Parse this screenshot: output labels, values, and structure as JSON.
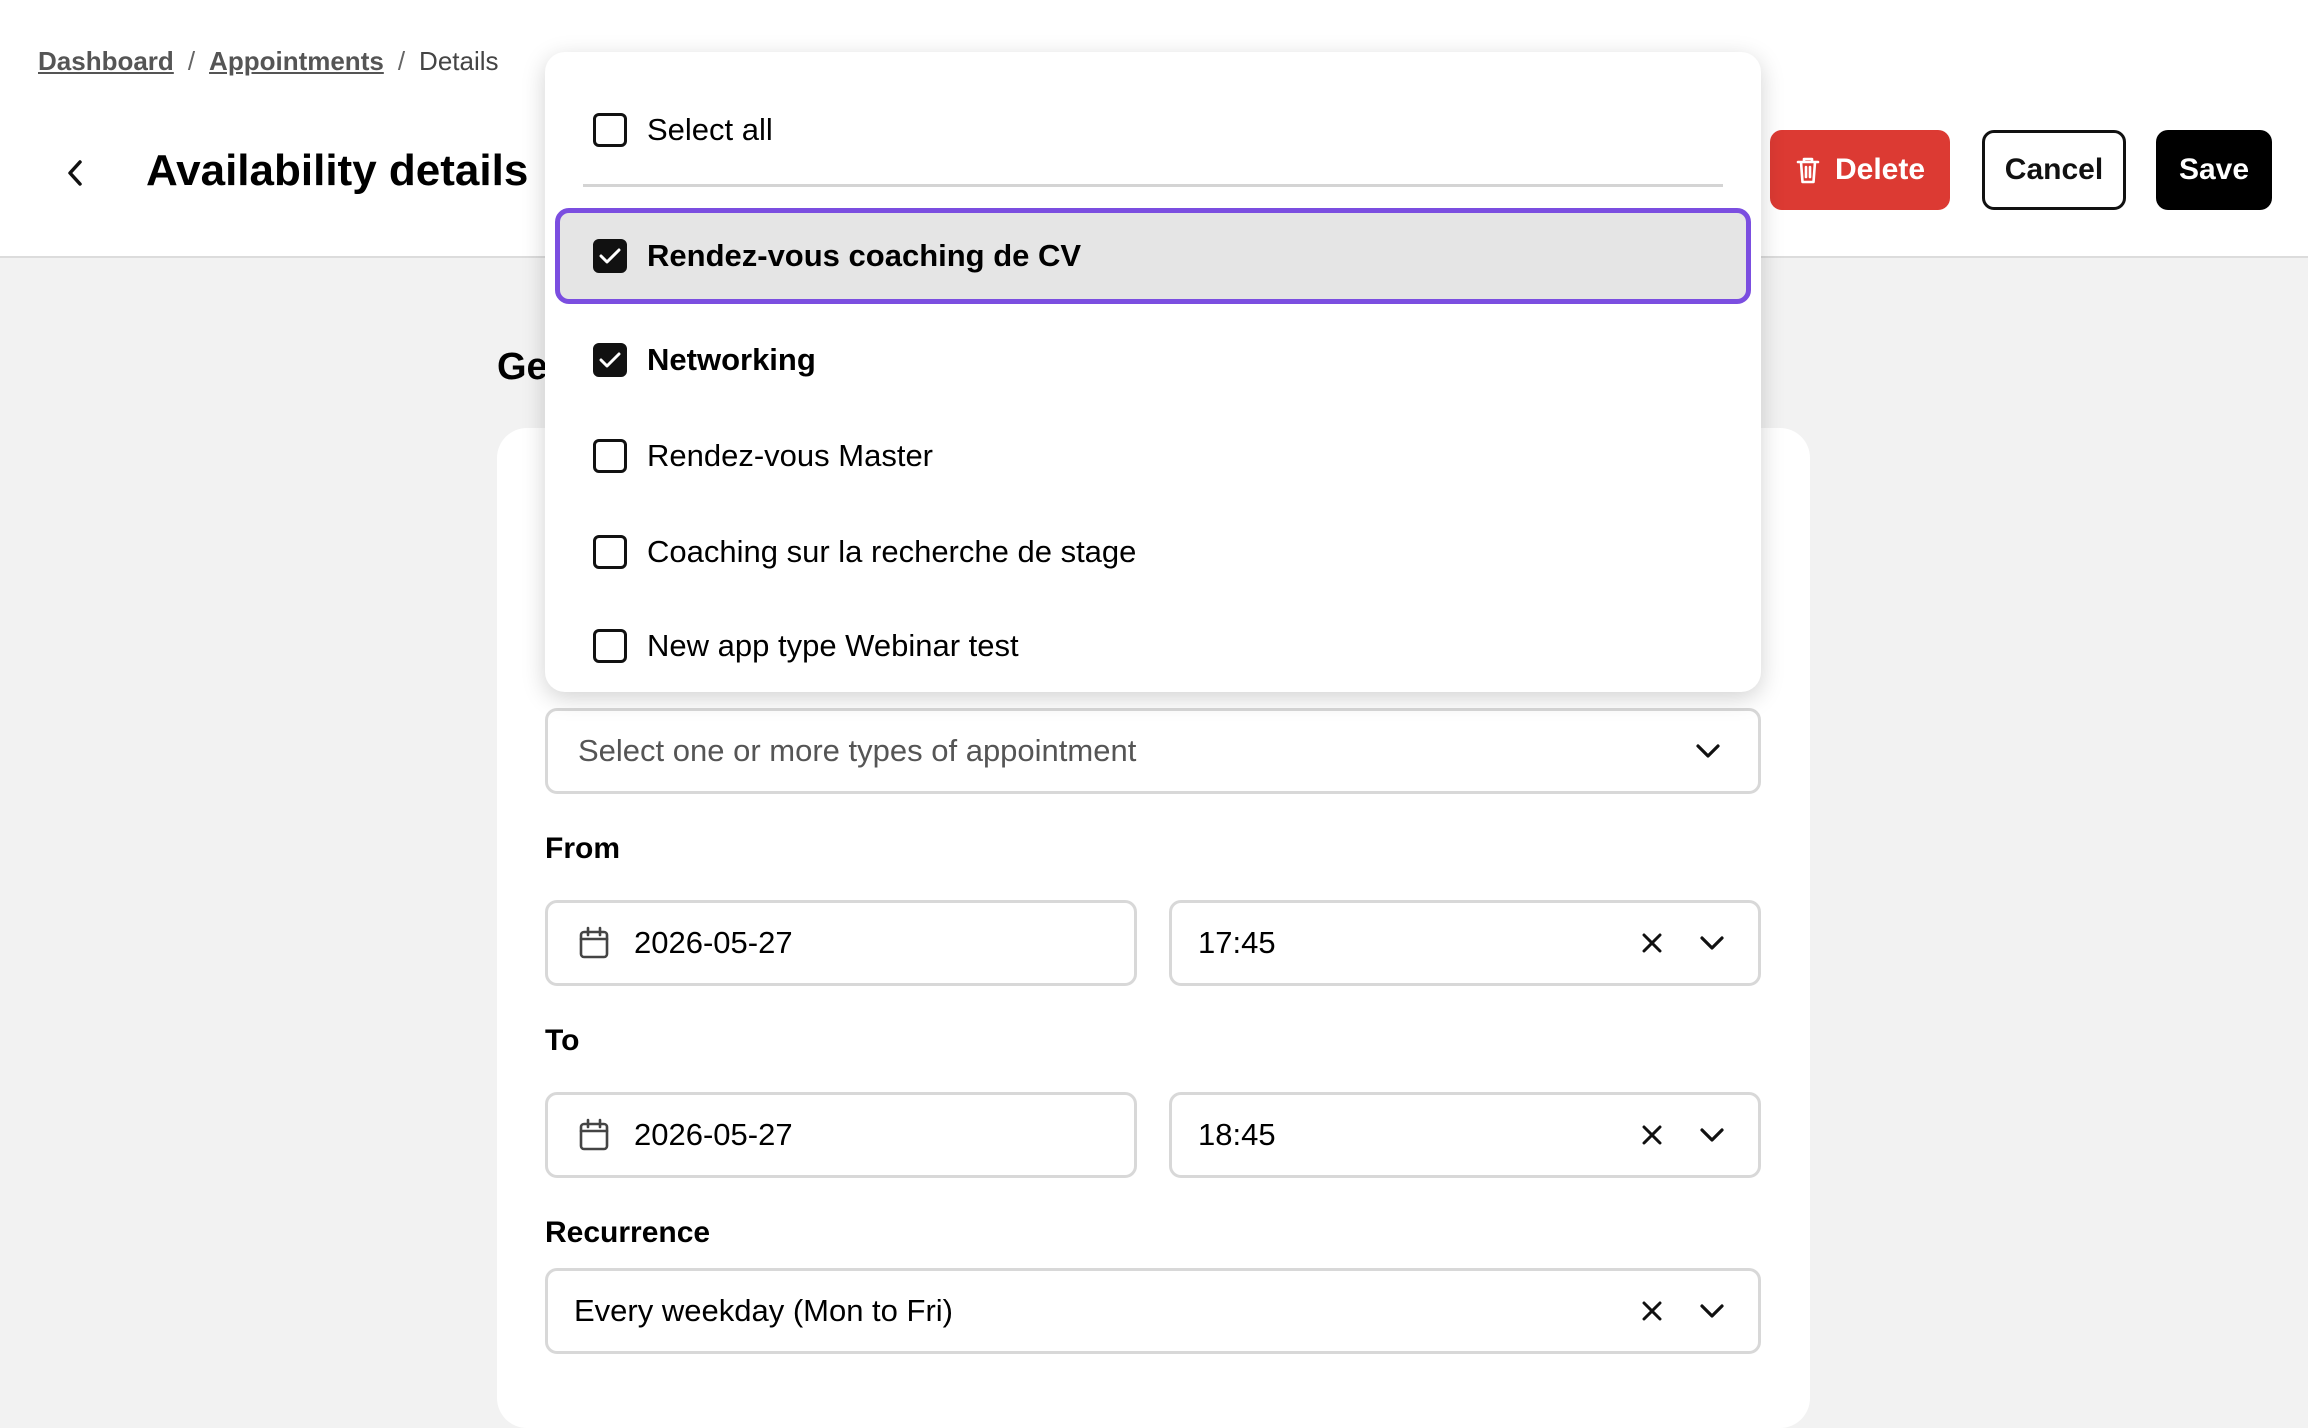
{
  "breadcrumb": {
    "items": [
      "Dashboard",
      "Appointments"
    ],
    "current": "Details",
    "separator": "/"
  },
  "header": {
    "title": "Availability details",
    "delete_label": "Delete",
    "cancel_label": "Cancel",
    "save_label": "Save"
  },
  "section": {
    "heading_partial": "Ge"
  },
  "appointment_types": {
    "placeholder": "Select one or more types of appointment",
    "select_all_label": "Select all",
    "options": [
      {
        "label": "Rendez-vous coaching de CV",
        "checked": true,
        "highlighted": true
      },
      {
        "label": "Networking",
        "checked": true,
        "highlighted": false
      },
      {
        "label": "Rendez-vous Master",
        "checked": false,
        "highlighted": false
      },
      {
        "label": "Coaching sur la recherche de stage",
        "checked": false,
        "highlighted": false
      },
      {
        "label": "New app type Webinar test",
        "checked": false,
        "highlighted": false
      }
    ]
  },
  "from": {
    "label": "From",
    "date": "2026-05-27",
    "time": "17:45"
  },
  "to": {
    "label": "To",
    "date": "2026-05-27",
    "time": "18:45"
  },
  "recurrence": {
    "label": "Recurrence",
    "value": "Every weekday (Mon to Fri)"
  },
  "colors": {
    "accent_focus": "#7b4ee0",
    "delete": "#dc3a33",
    "save": "#000000"
  },
  "icons": {
    "back": "chevron-left-icon",
    "delete": "trash-icon",
    "calendar": "calendar-icon",
    "clear": "close-icon",
    "expand": "chevron-down-icon",
    "check": "check-icon"
  }
}
